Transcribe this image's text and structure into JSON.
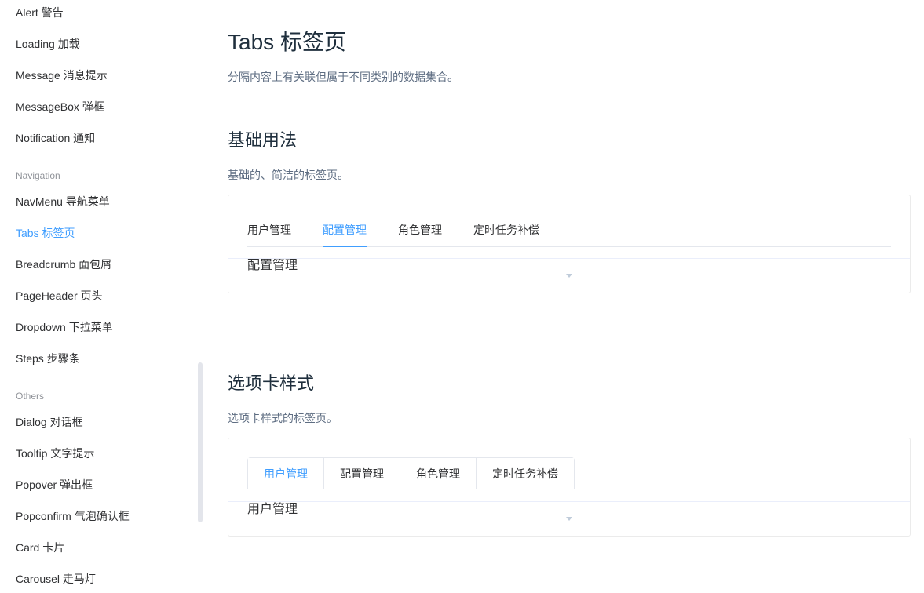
{
  "sidebar": {
    "items": [
      {
        "label": "Alert 警告"
      },
      {
        "label": "Loading 加载"
      },
      {
        "label": "Message 消息提示"
      },
      {
        "label": "MessageBox 弹框"
      },
      {
        "label": "Notification 通知"
      }
    ],
    "group_navigation": "Navigation",
    "navigation_items": [
      {
        "label": "NavMenu 导航菜单"
      },
      {
        "label": "Tabs 标签页",
        "active": true
      },
      {
        "label": "Breadcrumb 面包屑"
      },
      {
        "label": "PageHeader 页头"
      },
      {
        "label": "Dropdown 下拉菜单"
      },
      {
        "label": "Steps 步骤条"
      }
    ],
    "group_others": "Others",
    "others_items": [
      {
        "label": "Dialog 对话框"
      },
      {
        "label": "Tooltip 文字提示"
      },
      {
        "label": "Popover 弹出框"
      },
      {
        "label": "Popconfirm 气泡确认框"
      },
      {
        "label": "Card 卡片"
      },
      {
        "label": "Carousel 走马灯"
      }
    ]
  },
  "main": {
    "title": "Tabs 标签页",
    "description": "分隔内容上有关联但属于不同类别的数据集合。",
    "sections": [
      {
        "title": "基础用法",
        "description": "基础的、简洁的标签页。",
        "tabs": [
          "用户管理",
          "配置管理",
          "角色管理",
          "定时任务补偿"
        ],
        "active_tab": "配置管理",
        "content": "配置管理"
      },
      {
        "title": "选项卡样式",
        "description": "选项卡样式的标签页。",
        "tabs": [
          "用户管理",
          "配置管理",
          "角色管理",
          "定时任务补偿"
        ],
        "active_tab": "用户管理",
        "content": "用户管理"
      }
    ]
  },
  "colors": {
    "accent": "#409eff",
    "text": "#303133",
    "muted": "#5e6d82",
    "group": "#909399"
  }
}
